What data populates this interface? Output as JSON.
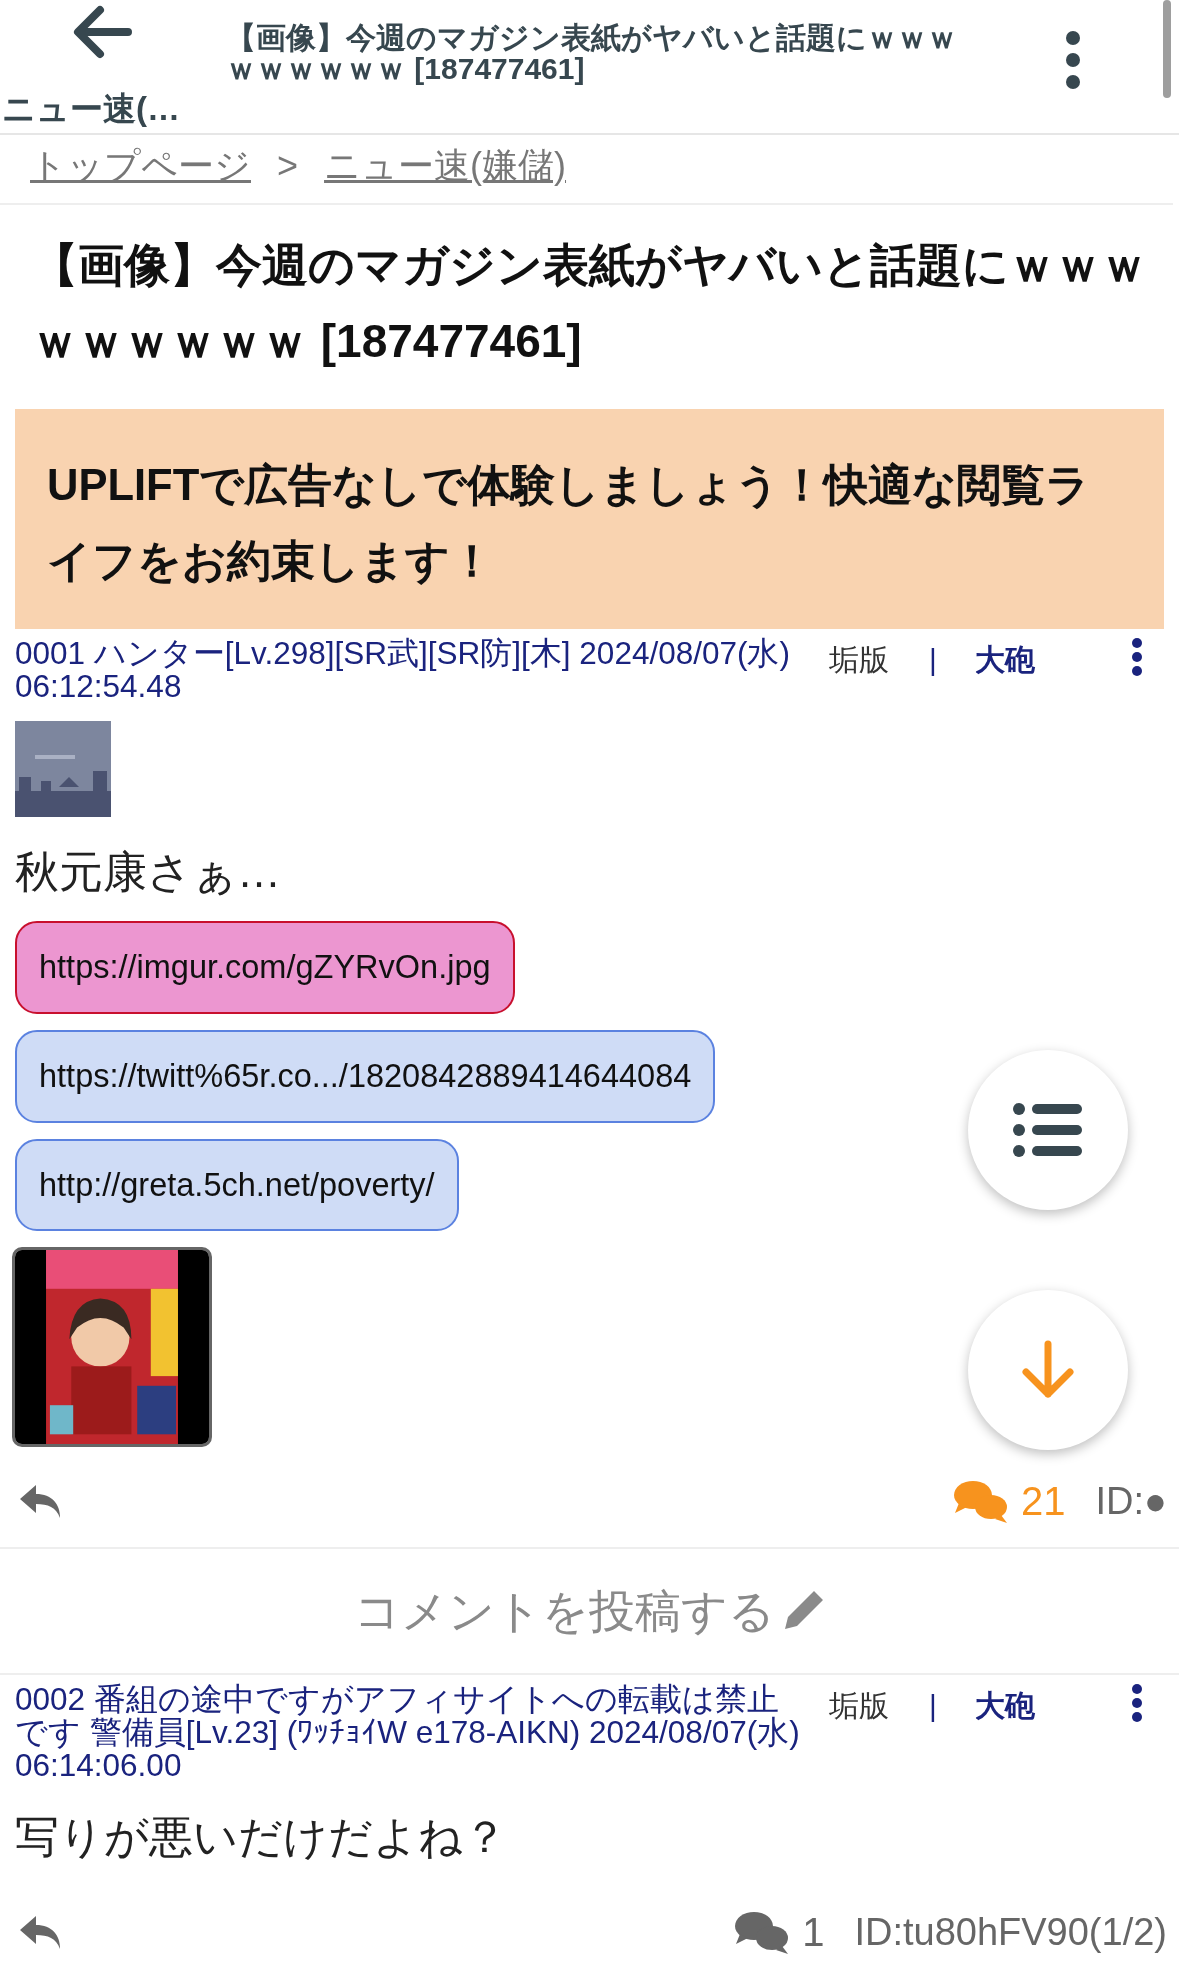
{
  "header": {
    "back_label": "ニュー速(…",
    "title": "【画像】今週のマガジン表紙がヤバいと話題にｗｗｗｗｗｗｗｗｗ [187477461]"
  },
  "breadcrumb": [
    "トップページ",
    "ニュー速(嫌儲)"
  ],
  "breadcrumb_separator": ">",
  "thread_title": "【画像】今週のマガジン表紙がヤバいと話題にｗｗｗｗｗｗｗｗｗ [187477461]",
  "ad_banner": "UPLIFTで広告なしで体験しましょう！快適な閲覧ライフをお約束します！",
  "posts": [
    {
      "header": "0001 ハンター[Lv.298][SR武][SR防][木] 2024/08/07(水) 06:12:54.48",
      "account_link": "垢版",
      "separator": "|",
      "cannon_link": "大砲",
      "body": "秋元康さぁ…",
      "links": [
        {
          "url": "https://imgur.com/gZYRvOn.jpg"
        },
        {
          "url": "https://twitt%65r.co.../1820842889414644084",
          "kind": "web"
        },
        {
          "url": "http://greta.5ch.net/poverty/",
          "kind": "web"
        }
      ],
      "reply_count": "21",
      "replies_highlighted": true,
      "id": "ID:●"
    },
    {
      "header": "0002 番組の途中ですがアフィサイトへの転載は禁止です 警備員[Lv.23] (ﾜｯﾁｮｲW e178-AIKN) 2024/08/07(水) 06:14:06.00",
      "account_link": "垢版",
      "separator": "|",
      "cannon_link": "大砲",
      "body": "写りが悪いだけだよね？",
      "reply_count": "1",
      "replies_highlighted": false,
      "id": "ID:tu80hFV90(1/2)"
    }
  ],
  "comment_button": "コメントを投稿する"
}
